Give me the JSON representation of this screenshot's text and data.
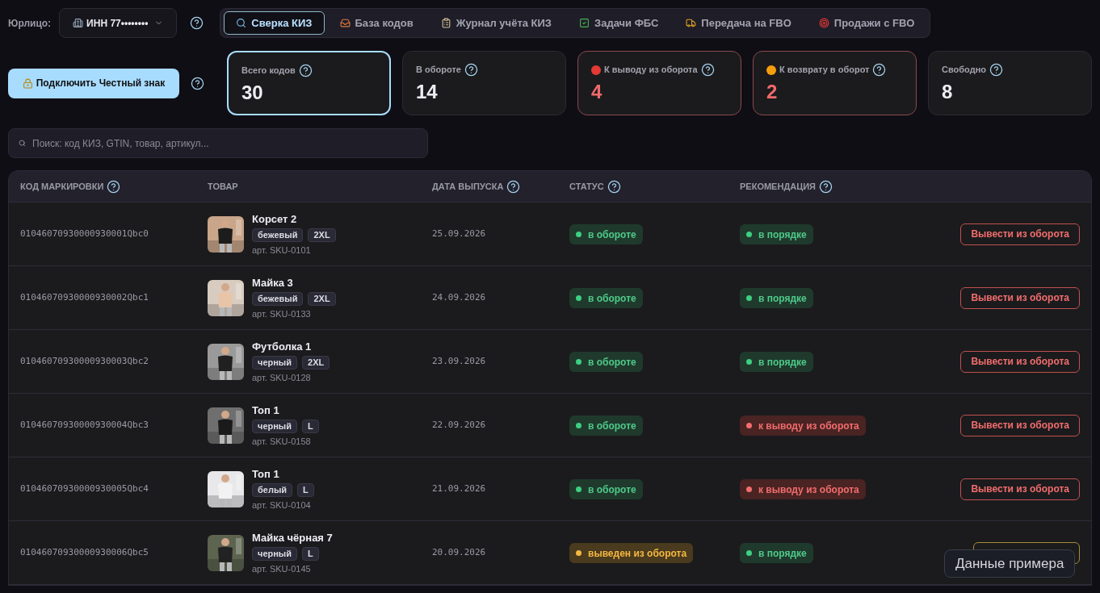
{
  "header": {
    "entity_label": "Юрлицо:",
    "entity_select": "ИНН 77••••••••",
    "tabs": [
      {
        "label": "Сверка КИЗ",
        "selected": true
      },
      {
        "label": "База кодов",
        "selected": false
      },
      {
        "label": "Журнал учёта КИЗ",
        "selected": false
      },
      {
        "label": "Задачи ФБС",
        "selected": false
      },
      {
        "label": "Передача на FBO",
        "selected": false
      },
      {
        "label": "Продажи с FBO",
        "selected": false
      }
    ]
  },
  "connect_button": "Подключить Честный знак",
  "stats": [
    {
      "label": "Всего кодов",
      "value": "30",
      "selected": true,
      "alert": false
    },
    {
      "label": "В обороте",
      "value": "14",
      "selected": false,
      "alert": false
    },
    {
      "label": "К выводу из оборота",
      "value": "4",
      "selected": false,
      "alert": true,
      "color": "#e53935"
    },
    {
      "label": "К возврату в оборот",
      "value": "2",
      "selected": false,
      "alert": true,
      "color": "#f59e0b"
    },
    {
      "label": "Свободно",
      "value": "8",
      "selected": false,
      "alert": false
    }
  ],
  "search": {
    "placeholder": "Поиск: код КИЗ, GTIN, товар, артикул..."
  },
  "table": {
    "columns": [
      {
        "label": "КОД МАРКИРОВКИ",
        "help": true
      },
      {
        "label": "ТОВАР",
        "help": false
      },
      {
        "label": "ДАТА ВЫПУСКА",
        "help": true
      },
      {
        "label": "СТАТУС",
        "help": true
      },
      {
        "label": "РЕКОМЕНДАЦИЯ",
        "help": true
      }
    ],
    "rows": [
      {
        "code": "01046070930000930001Qbc0",
        "name": "Корсет 2",
        "tags": [
          "бежевый",
          "2XL"
        ],
        "sku": "арт. SKU-0101",
        "date": "25.09.2026",
        "status": {
          "kind": "active",
          "label": "в обороте"
        },
        "recommendation": {
          "kind": "ok",
          "label": "в порядке"
        },
        "action": {
          "kind": "withdraw",
          "label": "Вывести из оборота"
        }
      },
      {
        "code": "01046070930000930002Qbc1",
        "name": "Майка 3",
        "tags": [
          "бежевый",
          "2XL"
        ],
        "sku": "арт. SKU-0133",
        "date": "24.09.2026",
        "status": {
          "kind": "active",
          "label": "в обороте"
        },
        "recommendation": {
          "kind": "ok",
          "label": "в порядке"
        },
        "action": {
          "kind": "withdraw",
          "label": "Вывести из оборота"
        }
      },
      {
        "code": "01046070930000930003Qbc2",
        "name": "Футболка 1",
        "tags": [
          "черный",
          "2XL"
        ],
        "sku": "арт. SKU-0128",
        "date": "23.09.2026",
        "status": {
          "kind": "active",
          "label": "в обороте"
        },
        "recommendation": {
          "kind": "ok",
          "label": "в порядке"
        },
        "action": {
          "kind": "withdraw",
          "label": "Вывести из оборота"
        }
      },
      {
        "code": "01046070930000930004Qbc3",
        "name": "Топ 1",
        "tags": [
          "черный",
          "L"
        ],
        "sku": "арт. SKU-0158",
        "date": "22.09.2026",
        "status": {
          "kind": "active",
          "label": "в обороте"
        },
        "recommendation": {
          "kind": "withdraw",
          "label": "к выводу из оборота"
        },
        "action": {
          "kind": "withdraw",
          "label": "Вывести из оборота"
        }
      },
      {
        "code": "01046070930000930005Qbc4",
        "name": "Топ 1",
        "tags": [
          "белый",
          "L"
        ],
        "sku": "арт. SKU-0104",
        "date": "21.09.2026",
        "status": {
          "kind": "active",
          "label": "в обороте"
        },
        "recommendation": {
          "kind": "withdraw",
          "label": "к выводу из оборота"
        },
        "action": {
          "kind": "withdraw",
          "label": "Вывести из оборота"
        }
      },
      {
        "code": "01046070930000930006Qbc5",
        "name": "Майка чёрная 7",
        "tags": [
          "черный",
          "L"
        ],
        "sku": "арт. SKU-0145",
        "date": "20.09.2026",
        "status": {
          "kind": "withdrawn",
          "label": "выведен из оборота"
        },
        "recommendation": {
          "kind": "ok",
          "label": "в порядке"
        },
        "action": {
          "kind": "return"
        }
      }
    ]
  },
  "overlay_badge": "Данные примера"
}
